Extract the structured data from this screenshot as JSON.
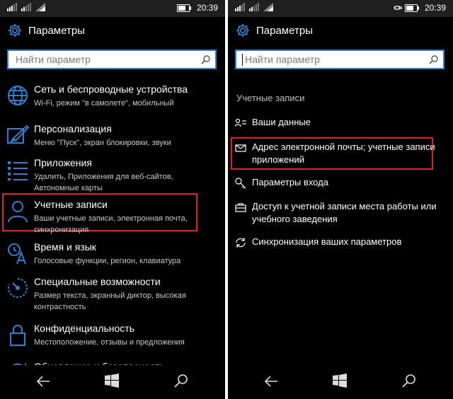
{
  "status": {
    "time": "20:39"
  },
  "app": {
    "title": "Параметры"
  },
  "search": {
    "placeholder": "Найти параметр"
  },
  "left_items": [
    {
      "title": "Сеть и беспроводные устройства",
      "subtitle": "Wi-Fi, режим \"в самолете\", мобильный",
      "icon": "globe-icon"
    },
    {
      "title": "Персонализация",
      "subtitle": "Меню \"Пуск\", экран блокировки, звуки",
      "icon": "paint-icon"
    },
    {
      "title": "Приложения",
      "subtitle": "Удалить, Приложения для веб-сайтов, Автономные карты",
      "icon": "apps-list-icon"
    },
    {
      "title": "Учетные записи",
      "subtitle": "Ваши учетные записи, электронная почта, синхронизация",
      "icon": "person-icon"
    },
    {
      "title": "Время и язык",
      "subtitle": "Голосовые функции, регион, клавиатура",
      "icon": "time-language-icon"
    },
    {
      "title": "Специальные возможности",
      "subtitle": "Размер текста, экранный диктор, высокая контрастность",
      "icon": "accessibility-icon"
    },
    {
      "title": "Конфиденциальность",
      "subtitle": "Местоположение, отзывы и предложения",
      "icon": "lock-icon"
    },
    {
      "title": "Обновление и безопасность",
      "subtitle": "",
      "icon": "update-icon"
    }
  ],
  "right": {
    "section": "Учетные записи",
    "items": [
      {
        "label": "Ваши данные",
        "icon": "person-card-icon"
      },
      {
        "label": "Адрес электронной почты; учетные записи приложений",
        "icon": "mail-icon"
      },
      {
        "label": "Параметры входа",
        "icon": "key-icon"
      },
      {
        "label": "Доступ к учетной записи места работы или учебного заведения",
        "icon": "briefcase-icon"
      },
      {
        "label": "Синхронизация ваших параметров",
        "icon": "sync-icon"
      }
    ]
  },
  "colors": {
    "accent": "#2d7fd0",
    "highlight": "#e02020",
    "background": "#000000"
  }
}
